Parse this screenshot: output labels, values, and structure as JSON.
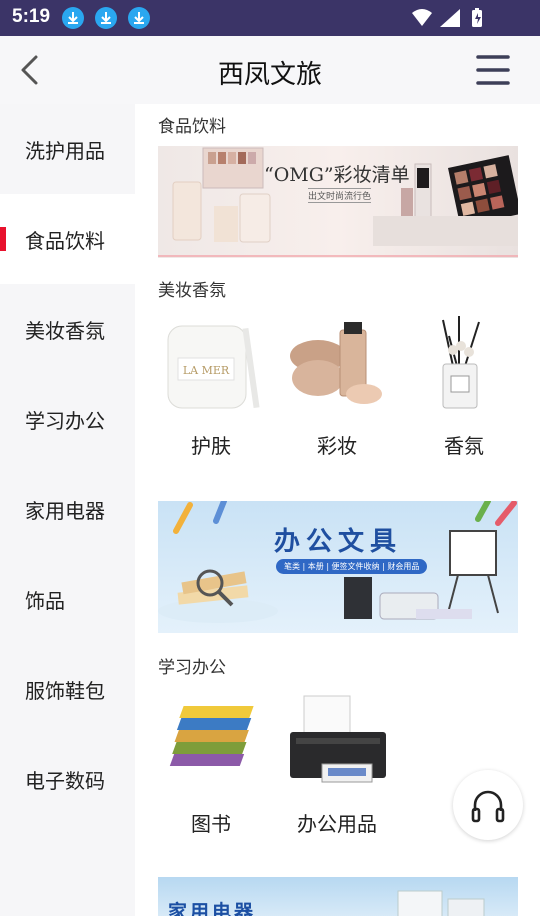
{
  "status_bar": {
    "time": "5:19"
  },
  "header": {
    "title": "西凤文旅"
  },
  "sidebar": {
    "items": [
      {
        "label": "洗护用品"
      },
      {
        "label": "食品饮料"
      },
      {
        "label": "美妆香氛"
      },
      {
        "label": "学习办公"
      },
      {
        "label": "家用电器"
      },
      {
        "label": "饰品"
      },
      {
        "label": "服饰鞋包"
      },
      {
        "label": "电子数码"
      }
    ],
    "active_index": 1
  },
  "sections": {
    "food": {
      "title": "食品饮料",
      "banner_title": "“OMG”彩妆清单",
      "banner_sub": "出文时尚流行色"
    },
    "beauty": {
      "title": "美妆香氛",
      "items": [
        {
          "label": "护肤"
        },
        {
          "label": "彩妆"
        },
        {
          "label": "香氛"
        }
      ]
    },
    "office_banner": {
      "title": "办公文具",
      "sub": "笔类 | 本册 | 便签文件收纳 | 财会用品"
    },
    "study": {
      "title": "学习办公",
      "items": [
        {
          "label": "图书"
        },
        {
          "label": "办公用品"
        }
      ]
    },
    "appliance_banner": {
      "title": "家用电器"
    }
  },
  "colors": {
    "status_bar": "#3b3467",
    "accent": "#e8112d",
    "sidebar_bg": "#f6f6f8"
  }
}
